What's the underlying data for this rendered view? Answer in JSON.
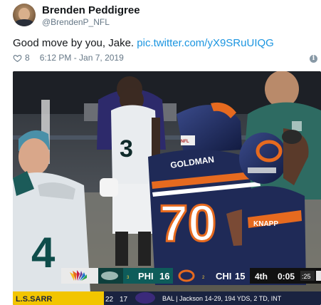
{
  "tweet": {
    "display_name": "Brenden Peddigree",
    "handle": "@BrendenP_NFL",
    "text_prefix": "Good move by you, Jake. ",
    "link_text": "pic.twitter.com/yX9SRuUIQG",
    "like_count": "8",
    "timestamp": "6:12 PM - Jan 7, 2019"
  },
  "icons": {
    "like": "heart-outline-icon",
    "info": "info-circle-icon"
  },
  "scorebug": {
    "network": "nbc-peacock-logo",
    "away_team": "PHI",
    "away_timeouts_digit": "3",
    "away_score": "16",
    "home_team": "CHI",
    "home_timeouts_digit": "2",
    "home_score": "15",
    "quarter": "4th",
    "clock": "0:05",
    "play_clock": ":25",
    "bottom_ticker": "BAL | Jackson 14-29, 194 YDS, 2 TD, INT",
    "bottom_left": "L.S.SARR",
    "bottom_score_a": "22",
    "bottom_score_b": "17"
  },
  "jerseys": {
    "bears_back_number": "70",
    "eagles_number_left": "4",
    "eagles_number_mid": "3",
    "bears_nameplate": "GOLDMAN",
    "bears_player_right_name": "KNAPP"
  },
  "colors": {
    "link": "#1b95e0",
    "muted": "#657786",
    "bears_navy": "#1f2a57",
    "bears_orange": "#e66a1f",
    "eagles_green": "#0e5c5a"
  }
}
